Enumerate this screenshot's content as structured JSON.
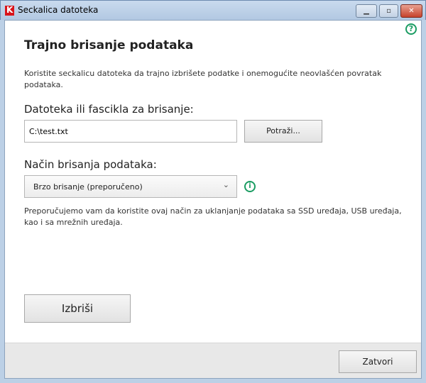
{
  "window": {
    "title": "Seckalica datoteka",
    "minimize": "▁",
    "maximize": "▫",
    "close": "✕"
  },
  "main": {
    "heading": "Trajno brisanje podataka",
    "description": "Koristite seckalicu datoteka da trajno izbrišete podatke i onemogućite neovlašćen povratak podataka.",
    "file_label": "Datoteka ili fascikla za brisanje:",
    "file_value": "C:\\test.txt",
    "browse_label": "Potraži...",
    "method_label": "Način brisanja podataka:",
    "method_selected": "Brzo brisanje (preporučeno)",
    "method_note": "Preporučujemo vam da koristite ovaj način za uklanjanje podataka sa SSD uređaja, USB uređaja, kao i sa mrežnih uređaja.",
    "delete_label": "Izbriši"
  },
  "footer": {
    "close_label": "Zatvori"
  },
  "icons": {
    "help": "?",
    "info": "i",
    "chevron": "⌄"
  },
  "colors": {
    "accent": "#1a9c62"
  }
}
